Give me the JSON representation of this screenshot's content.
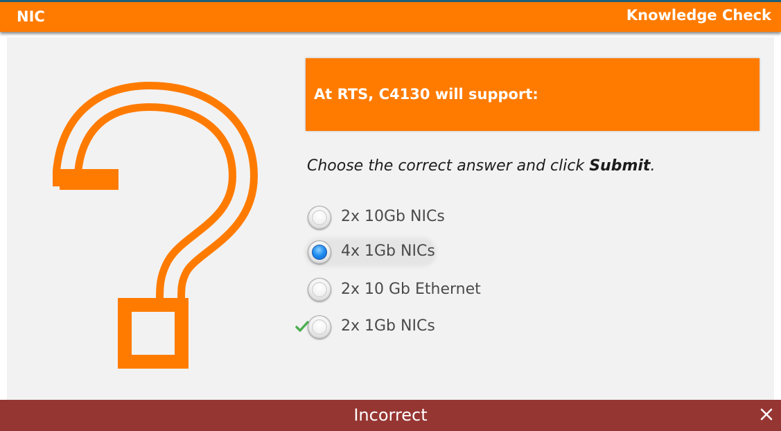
{
  "header": {
    "left_title": "NIC",
    "right_title": "Knowledge Check"
  },
  "question": {
    "text": "At RTS, C4130 will support:",
    "instruction_prefix": "Choose the correct answer and click ",
    "instruction_bold": "Submit",
    "instruction_suffix": "."
  },
  "options": [
    {
      "label": "2x 10Gb NICs",
      "selected": false,
      "correct": false
    },
    {
      "label": "4x 1Gb NICs",
      "selected": true,
      "correct": false
    },
    {
      "label": "2x 10 Gb Ethernet",
      "selected": false,
      "correct": false
    },
    {
      "label": "2x 1Gb NICs",
      "selected": false,
      "correct": true
    }
  ],
  "feedback": {
    "message": "Incorrect"
  },
  "icons": {
    "question_mark": "question-mark-icon",
    "correct_check": "checkmark-icon",
    "close": "close-icon"
  },
  "colors": {
    "accent": "#ff7b00",
    "feedback_bg": "#963633",
    "selected_radio": "#1e8cf0",
    "check": "#4caf50"
  }
}
